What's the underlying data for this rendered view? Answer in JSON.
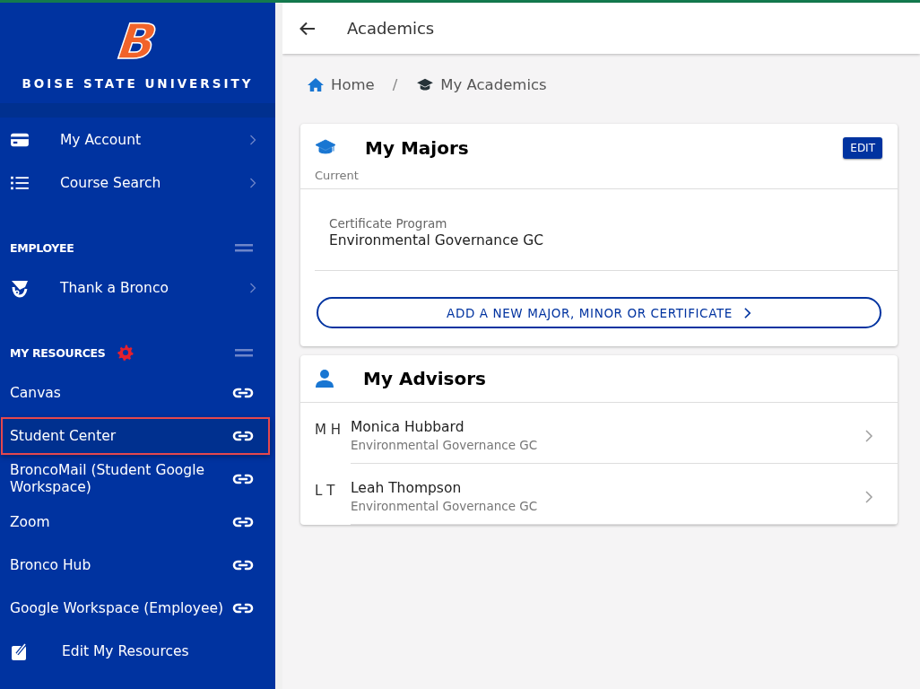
{
  "sidebar": {
    "logo_letter": "B",
    "university": "BOISE STATE UNIVERSITY",
    "items": [
      {
        "kind": "nav",
        "label": "My Account"
      },
      {
        "kind": "nav",
        "label": "Course Search"
      },
      {
        "kind": "section",
        "label": "EMPLOYEE",
        "settings": false
      },
      {
        "kind": "nav",
        "label": "Thank a Bronco"
      },
      {
        "kind": "section",
        "label": "MY RESOURCES",
        "settings": true
      },
      {
        "kind": "link",
        "label": "Canvas",
        "highlighted": false
      },
      {
        "kind": "link",
        "label": "Student Center",
        "highlighted": true
      },
      {
        "kind": "link",
        "label": "BroncoMail (Student Google Workspace)",
        "highlighted": false
      },
      {
        "kind": "link",
        "label": "Zoom",
        "highlighted": false
      },
      {
        "kind": "link",
        "label": "Bronco Hub",
        "highlighted": false
      },
      {
        "kind": "link",
        "label": "Google Workspace (Employee)",
        "highlighted": false
      },
      {
        "kind": "action",
        "label": "Edit My Resources"
      }
    ]
  },
  "header": {
    "title": "Academics"
  },
  "breadcrumb": [
    {
      "label": "Home"
    },
    {
      "label": "My Academics"
    }
  ],
  "breadcrumb_separator": "/",
  "majors": {
    "title": "My Majors",
    "edit_button": "EDIT",
    "subtitle": "Current",
    "programs": [
      {
        "type": "Certificate Program",
        "name": "Environmental Governance GC"
      }
    ],
    "add_button": "ADD A NEW MAJOR, MINOR OR CERTIFICATE"
  },
  "advisors": {
    "title": "My Advisors",
    "rows": [
      {
        "initials": "M H",
        "name": "Monica Hubbard",
        "program": "Environmental Governance GC"
      },
      {
        "initials": "L T",
        "name": "Leah Thompson",
        "program": "Environmental Governance GC"
      }
    ]
  }
}
